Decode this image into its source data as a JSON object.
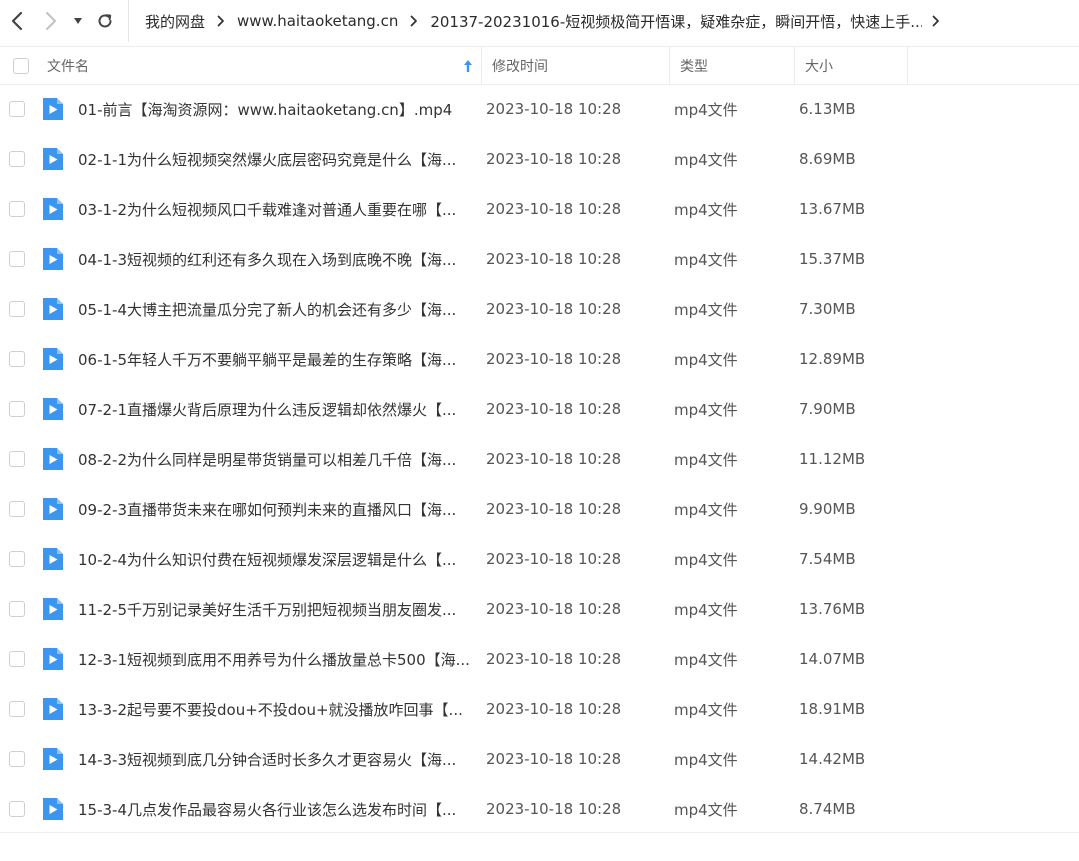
{
  "breadcrumb": [
    "我的网盘",
    "www.haitaoketang.cn",
    "20137-20231016-短视频极简开悟课，疑难杂症，瞬间开悟，快速上手..."
  ],
  "columns": {
    "name": "文件名",
    "mtime": "修改时间",
    "type": "类型",
    "size": "大小"
  },
  "icons": {
    "back": "chevron-left-icon",
    "forward": "chevron-right-icon",
    "dropdown": "caret-down-icon",
    "refresh": "refresh-icon",
    "sort": "sort-ascending-icon",
    "file": "video-file-icon"
  },
  "colors": {
    "accent": "#3c96f0",
    "file_icon": "#3c96f0"
  },
  "files": [
    {
      "name": "01-前言【海淘资源网：www.haitaoketang.cn】.mp4",
      "mtime": "2023-10-18 10:28",
      "type": "mp4文件",
      "size": "6.13MB"
    },
    {
      "name": "02-1-1为什么短视频突然爆火底层密码究竟是什么【海...",
      "mtime": "2023-10-18 10:28",
      "type": "mp4文件",
      "size": "8.69MB"
    },
    {
      "name": "03-1-2为什么短视频风口千载难逢对普通人重要在哪【...",
      "mtime": "2023-10-18 10:28",
      "type": "mp4文件",
      "size": "13.67MB"
    },
    {
      "name": "04-1-3短视频的红利还有多久现在入场到底晚不晚【海...",
      "mtime": "2023-10-18 10:28",
      "type": "mp4文件",
      "size": "15.37MB"
    },
    {
      "name": "05-1-4大博主把流量瓜分完了新人的机会还有多少【海...",
      "mtime": "2023-10-18 10:28",
      "type": "mp4文件",
      "size": "7.30MB"
    },
    {
      "name": "06-1-5年轻人千万不要躺平躺平是最差的生存策略【海...",
      "mtime": "2023-10-18 10:28",
      "type": "mp4文件",
      "size": "12.89MB"
    },
    {
      "name": "07-2-1直播爆火背后原理为什么违反逻辑却依然爆火【...",
      "mtime": "2023-10-18 10:28",
      "type": "mp4文件",
      "size": "7.90MB"
    },
    {
      "name": "08-2-2为什么同样是明星带货销量可以相差几千倍【海...",
      "mtime": "2023-10-18 10:28",
      "type": "mp4文件",
      "size": "11.12MB"
    },
    {
      "name": "09-2-3直播带货未来在哪如何预判未来的直播风口【海...",
      "mtime": "2023-10-18 10:28",
      "type": "mp4文件",
      "size": "9.90MB"
    },
    {
      "name": "10-2-4为什么知识付费在短视频爆发深层逻辑是什么【...",
      "mtime": "2023-10-18 10:28",
      "type": "mp4文件",
      "size": "7.54MB"
    },
    {
      "name": "11-2-5千万别记录美好生活千万别把短视频当朋友圈发...",
      "mtime": "2023-10-18 10:28",
      "type": "mp4文件",
      "size": "13.76MB"
    },
    {
      "name": "12-3-1短视频到底用不用养号为什么播放量总卡500【海...",
      "mtime": "2023-10-18 10:28",
      "type": "mp4文件",
      "size": "14.07MB"
    },
    {
      "name": "13-3-2起号要不要投dou+不投dou+就没播放咋回事【...",
      "mtime": "2023-10-18 10:28",
      "type": "mp4文件",
      "size": "18.91MB"
    },
    {
      "name": "14-3-3短视频到底几分钟合适时长多久才更容易火【海...",
      "mtime": "2023-10-18 10:28",
      "type": "mp4文件",
      "size": "14.42MB"
    },
    {
      "name": "15-3-4几点发作品最容易火各行业该怎么选发布时间【...",
      "mtime": "2023-10-18 10:28",
      "type": "mp4文件",
      "size": "8.74MB"
    }
  ]
}
